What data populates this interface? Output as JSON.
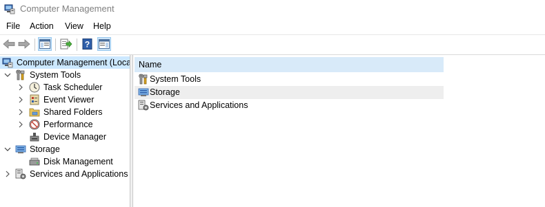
{
  "window": {
    "title": "Computer Management",
    "icon": "computer-management-icon"
  },
  "menu": [
    {
      "label": "File"
    },
    {
      "label": "Action"
    },
    {
      "label": "View"
    },
    {
      "label": "Help"
    }
  ],
  "toolbar": {
    "buttons": [
      "back-icon",
      "forward-icon",
      "show-hide-console-tree-icon",
      "export-list-icon",
      "help-icon",
      "show-hide-action-pane-icon"
    ]
  },
  "tree": {
    "items": [
      {
        "label": "Computer Management (Local",
        "icon": "computer-management-icon",
        "expander": "",
        "selected": true
      },
      {
        "label": "System Tools",
        "icon": "system-tools-icon",
        "expander": "expanded"
      },
      {
        "label": "Task Scheduler",
        "icon": "task-scheduler-icon",
        "expander": "collapsed"
      },
      {
        "label": "Event Viewer",
        "icon": "event-viewer-icon",
        "expander": "collapsed"
      },
      {
        "label": "Shared Folders",
        "icon": "shared-folders-icon",
        "expander": "collapsed"
      },
      {
        "label": "Performance",
        "icon": "performance-icon",
        "expander": "collapsed"
      },
      {
        "label": "Device Manager",
        "icon": "device-manager-icon",
        "expander": ""
      },
      {
        "label": "Storage",
        "icon": "storage-icon",
        "expander": "expanded"
      },
      {
        "label": "Disk Management",
        "icon": "disk-management-icon",
        "expander": ""
      },
      {
        "label": "Services and Applications",
        "icon": "services-and-applications-icon",
        "expander": "collapsed"
      }
    ]
  },
  "list": {
    "column_header": "Name",
    "items": [
      {
        "label": "System Tools",
        "icon": "system-tools-icon"
      },
      {
        "label": "Storage",
        "icon": "storage-icon",
        "hover": true
      },
      {
        "label": "Services and Applications",
        "icon": "services-and-applications-icon"
      }
    ]
  },
  "colors": {
    "selection": "#cce8ff",
    "header": "#d8eaf9",
    "hover": "#eeeeee"
  }
}
